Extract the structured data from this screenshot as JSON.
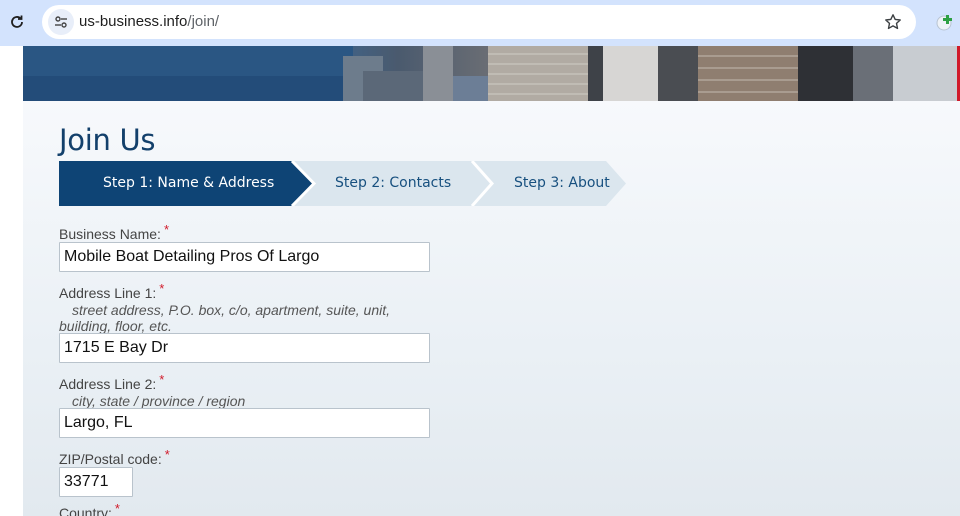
{
  "browser": {
    "url_host": "us-business.info",
    "url_path": "/join/"
  },
  "page": {
    "title": "Join Us",
    "steps": [
      {
        "label": "Step 1: Name & Address",
        "active": true
      },
      {
        "label": "Step 2: Contacts",
        "active": false
      },
      {
        "label": "Step 3: About",
        "active": false
      }
    ],
    "required_mark": "*",
    "fields": {
      "business_name": {
        "label": "Business Name:",
        "value": "Mobile Boat Detailing Pros Of Largo"
      },
      "address_line_1": {
        "label": "Address Line 1:",
        "hint_line1": "street address, P.O. box, c/o, apartment, suite, unit,",
        "hint_line2": "building, floor, etc.",
        "value": "1715 E Bay Dr"
      },
      "address_line_2": {
        "label": "Address Line 2:",
        "hint": "city, state / province / region",
        "value": "Largo, FL"
      },
      "zip": {
        "label": "ZIP/Postal code:",
        "value": "33771"
      },
      "country": {
        "label": "Country:"
      }
    }
  },
  "colors": {
    "active_step": "#0e4475",
    "inactive_step": "#dbe6ee",
    "title": "#13406b",
    "required": "#d11a2a"
  }
}
